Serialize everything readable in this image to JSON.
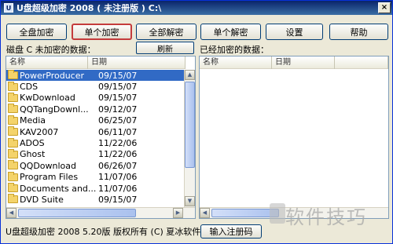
{
  "window": {
    "title": "U盘超级加密 2008 ( 未注册版 ) C:\\"
  },
  "toolbar": {
    "buttons": [
      "全盘加密",
      "单个加密",
      "全部解密",
      "单个解密",
      "设置",
      "帮助"
    ],
    "active_index": 1
  },
  "left_panel": {
    "label": "磁盘 C 未加密的数据：",
    "refresh_label": "刷新",
    "columns": [
      "名称",
      "日期"
    ],
    "items": [
      {
        "name": "PowerProducer",
        "date": "09/15/07",
        "selected": true
      },
      {
        "name": "CDS",
        "date": "09/15/07"
      },
      {
        "name": "KwDownload",
        "date": "09/15/07"
      },
      {
        "name": "QQTangDownl...",
        "date": "09/12/07"
      },
      {
        "name": "Media",
        "date": "06/25/07"
      },
      {
        "name": "KAV2007",
        "date": "06/11/07"
      },
      {
        "name": "ADOS",
        "date": "11/22/06"
      },
      {
        "name": "Ghost",
        "date": "11/22/06"
      },
      {
        "name": "QQDownload",
        "date": "06/26/07"
      },
      {
        "name": "Program Files",
        "date": "11/07/06"
      },
      {
        "name": "Documents and...",
        "date": "11/07/06"
      },
      {
        "name": "DVD Suite",
        "date": "09/15/07"
      }
    ]
  },
  "right_panel": {
    "label": "已经加密的数据：",
    "columns": [
      "名称",
      "日期",
      ""
    ]
  },
  "status": {
    "text": "U盘超级加密 2008  5.20版 版权所有 (C) 夏冰软件。",
    "register_label": "输入注册码"
  },
  "watermark": {
    "text": "软件技巧"
  },
  "colors": {
    "selection": "#316ac5",
    "titlebar": "#0a246a",
    "active_button_border": "#c43c3c"
  }
}
